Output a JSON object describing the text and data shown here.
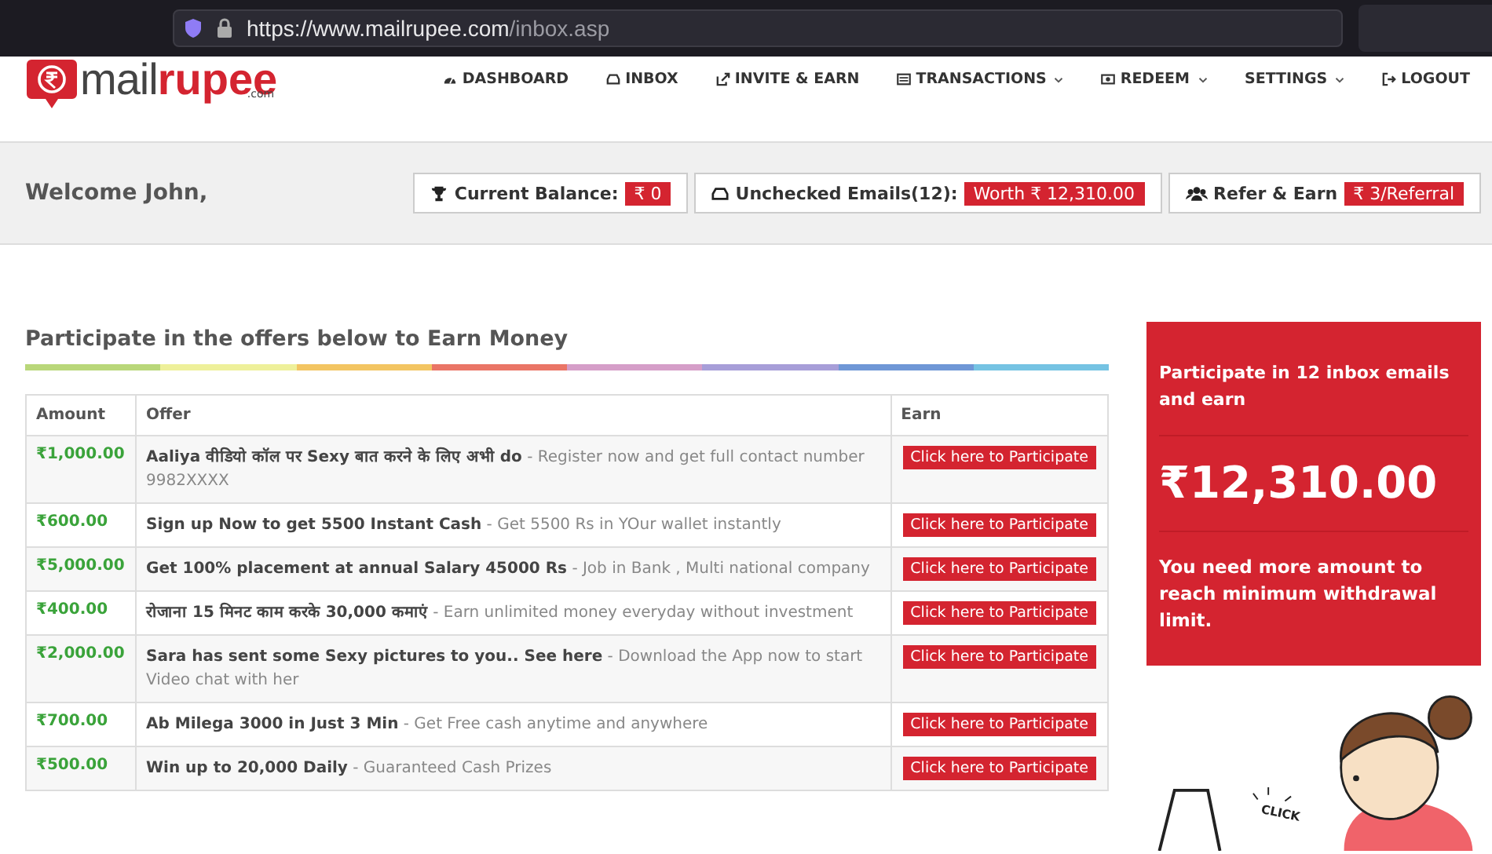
{
  "browser": {
    "url_host": "https://www.mailrupee.com",
    "url_path": "/inbox.asp"
  },
  "header": {
    "logo_text_1": "mail",
    "logo_text_2": "rupee",
    "logo_sub": ".com",
    "nav": [
      {
        "label": "DASHBOARD",
        "kind": "dashboard",
        "dropdown": false
      },
      {
        "label": "INBOX",
        "kind": "inbox",
        "dropdown": false
      },
      {
        "label": "INVITE & EARN",
        "kind": "share",
        "dropdown": false
      },
      {
        "label": "TRANSACTIONS",
        "kind": "list",
        "dropdown": true
      },
      {
        "label": "REDEEM",
        "kind": "money",
        "dropdown": true
      },
      {
        "label": "SETTINGS",
        "kind": "plain",
        "dropdown": true
      },
      {
        "label": "LOGOUT",
        "kind": "logout",
        "dropdown": false
      }
    ]
  },
  "welcome": {
    "text": "Welcome John,",
    "stats": [
      {
        "kind": "trophy",
        "label": "Current Balance:",
        "badge": "₹ 0"
      },
      {
        "kind": "inbox",
        "label": "Unchecked Emails(12):",
        "badge": "Worth ₹ 12,310.00"
      },
      {
        "kind": "users",
        "label": "Refer & Earn",
        "badge": "₹ 3/Referral"
      }
    ]
  },
  "offers": {
    "heading": "Participate in the offers below to Earn Money",
    "columns": [
      "Amount",
      "Offer",
      "Earn"
    ],
    "rows": [
      {
        "amount": "₹1,000.00",
        "title": "Aaliya वीडियो कॉल पर Sexy बात करने के लिए अभी do",
        "desc": "- Register now and get full contact number 9982XXXX",
        "button": "Click here to Participate"
      },
      {
        "amount": "₹600.00",
        "title": "Sign up Now to get 5500 Instant Cash",
        "desc": "- Get 5500 Rs in YOur wallet instantly",
        "button": "Click here to Participate"
      },
      {
        "amount": "₹5,000.00",
        "title": "Get 100% placement at annual Salary 45000 Rs",
        "desc": "- Job in Bank , Multi national company",
        "button": "Click here to Participate"
      },
      {
        "amount": "₹400.00",
        "title": "रोजाना 15 मिनट काम करके 30,000 कमाएं",
        "desc": "- Earn unlimited money everyday without investment",
        "button": "Click here to Participate"
      },
      {
        "amount": "₹2,000.00",
        "title": "Sara has sent some Sexy pictures to you.. See here",
        "desc": "- Download the App now to start Video chat with her",
        "button": "Click here to Participate"
      },
      {
        "amount": "₹700.00",
        "title": "Ab Milega 3000 in Just 3 Min",
        "desc": "- Get Free cash anytime and anywhere",
        "button": "Click here to Participate"
      },
      {
        "amount": "₹500.00",
        "title": "Win up to 20,000 Daily",
        "desc": "- Guaranteed Cash Prizes",
        "button": "Click here to Participate"
      }
    ]
  },
  "promo": {
    "title": "Participate in 12 inbox emails and earn",
    "amount": "₹12,310.00",
    "note": "You need more amount to reach minimum withdrawal limit."
  },
  "illustration": {
    "caption": "CLICK"
  }
}
